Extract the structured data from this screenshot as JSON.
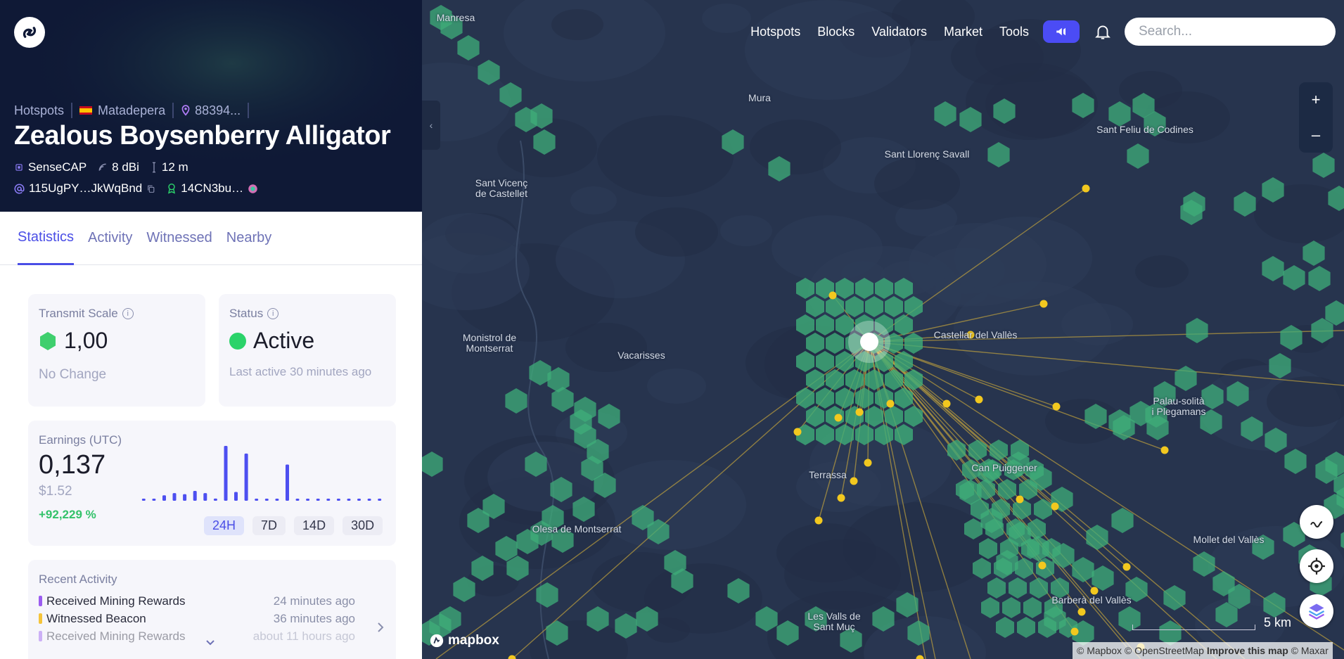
{
  "nav": {
    "links": [
      "Hotspots",
      "Blocks",
      "Validators",
      "Market",
      "Tools"
    ],
    "search_placeholder": "Search..."
  },
  "header": {
    "breadcrumb": {
      "root": "Hotspots",
      "city": "Matadepera",
      "location": "88394..."
    },
    "title": "Zealous Boysenberry Alligator",
    "maker": "SenseCAP",
    "gain": "8 dBi",
    "elevation": "12 m",
    "address": "115UgPY…JkWqBnd",
    "owner": "14CN3bu…"
  },
  "tabs": [
    "Statistics",
    "Activity",
    "Witnessed",
    "Nearby"
  ],
  "transmit_scale": {
    "label": "Transmit Scale",
    "value": "1,00",
    "change": "No Change"
  },
  "status": {
    "label": "Status",
    "value": "Active",
    "last_active": "Last active 30 minutes ago"
  },
  "earnings": {
    "label": "Earnings (UTC)",
    "value": "0,137",
    "usd": "$1.52",
    "change": "+92,229 %",
    "ranges": [
      "24H",
      "7D",
      "14D",
      "30D"
    ],
    "bars": [
      0.03,
      0.03,
      0.1,
      0.14,
      0.12,
      0.18,
      0.14,
      0.04,
      1.0,
      0.16,
      0.86,
      0.03,
      0.03,
      0.03,
      0.66,
      0.03,
      0.03,
      0.03,
      0.03,
      0.03,
      0.03,
      0.03,
      0.03,
      0.03
    ]
  },
  "recent_activity": {
    "label": "Recent Activity",
    "items": [
      {
        "text": "Received Mining Rewards",
        "time": "24 minutes ago",
        "color": "#9b5cf0"
      },
      {
        "text": "Witnessed Beacon",
        "time": "36 minutes ago",
        "color": "#f5c43a"
      },
      {
        "text": "Received Mining Rewards",
        "time": "about 11 hours ago",
        "color": "#9b5cf0"
      }
    ]
  },
  "map": {
    "places": [
      "Manresa",
      "Mura",
      "Sant Llorenç Savall",
      "Sant Feliu de Codines",
      "Sant Vicenç\nde Castellet",
      "Monistrol de\nMontserrat",
      "Vacarisses",
      "Castellar del Vallès",
      "Palau-solità\ni Plegamans",
      "Terrassa",
      "Can Puiggener",
      "Olesa de Montserrat",
      "Mollet del Vallès",
      "Barberà del Vallès",
      "Les Valls de\nSant Muç"
    ],
    "scale_label": "5 km",
    "brand": "mapbox",
    "attribution": "© Mapbox © OpenStreetMap",
    "improve": "Improve this map",
    "attribution_end": "© Maxar"
  },
  "colors": {
    "accent": "#4a4ee6",
    "hex": "#3fae79",
    "witness": "#f2c81f",
    "active": "#2bd36a"
  }
}
